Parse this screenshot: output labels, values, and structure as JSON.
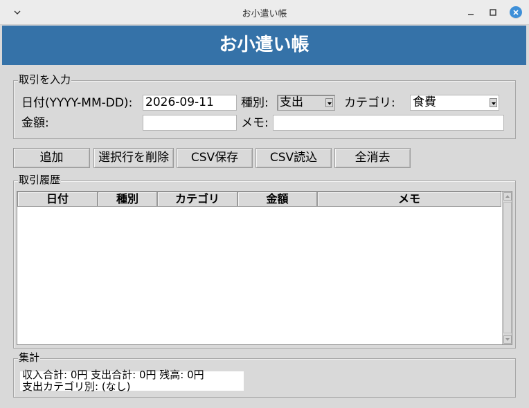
{
  "window": {
    "title": "お小遣い帳",
    "menu_icon": "chevron-down-icon",
    "minimize_icon": "minimize-icon",
    "maximize_icon": "maximize-icon",
    "close_icon": "close-icon"
  },
  "banner": {
    "text": "お小遣い帳",
    "bg_color": "#3572a8"
  },
  "input_frame": {
    "legend": "取引を入力",
    "date_label": "日付(YYYY-MM-DD):",
    "date_value": "2026-09-11",
    "type_label": "種別:",
    "type_value": "支出",
    "category_label": "カテゴリ:",
    "category_value": "食費",
    "amount_label": "金額:",
    "amount_value": "",
    "memo_label": "メモ:",
    "memo_value": ""
  },
  "buttons": {
    "add": "追加",
    "delete_selected": "選択行を削除",
    "csv_save": "CSV保存",
    "csv_load": "CSV読込",
    "clear_all": "全消去"
  },
  "history": {
    "legend": "取引履歴",
    "columns": [
      "日付",
      "種別",
      "カテゴリ",
      "金額",
      "メモ"
    ],
    "rows": []
  },
  "summary": {
    "legend": "集計",
    "line1": "収入合計: 0円  支出合計: 0円  残高: 0円",
    "line2": "支出カテゴリ別: (なし)"
  }
}
